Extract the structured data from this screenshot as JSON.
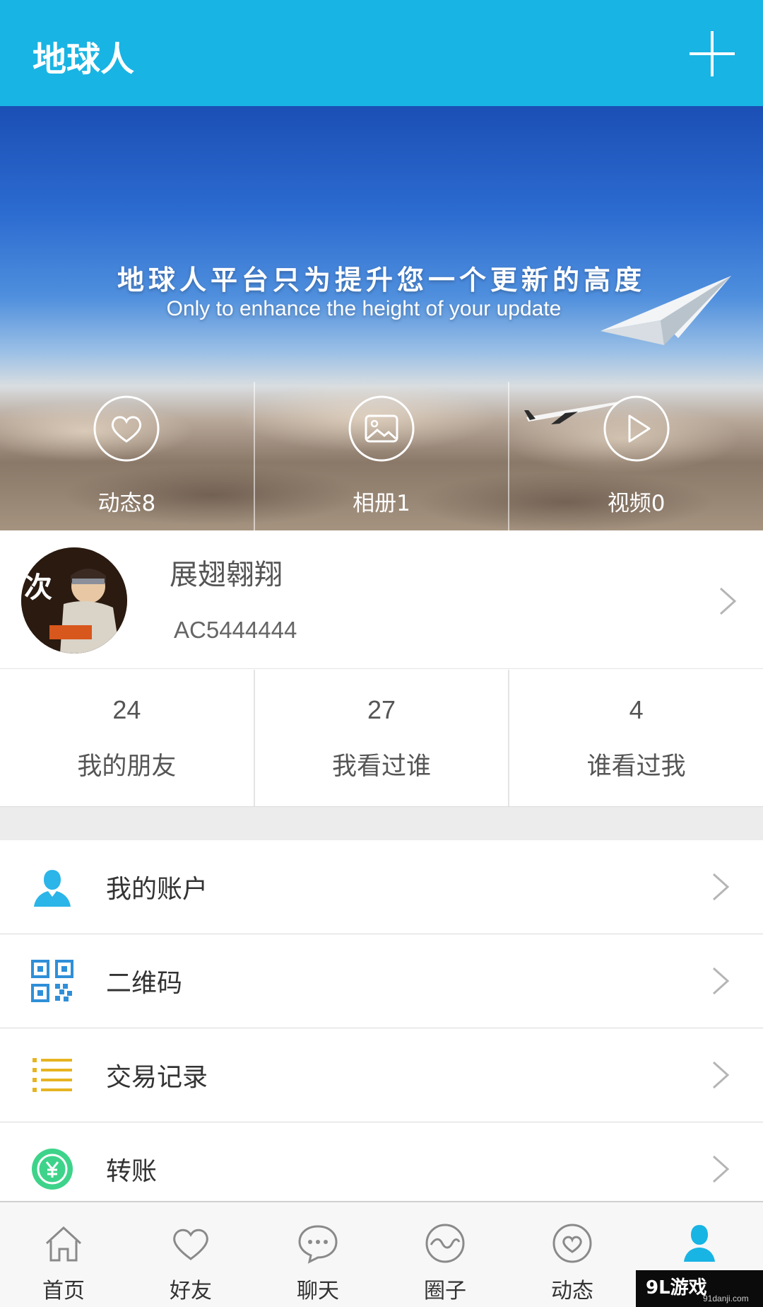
{
  "header": {
    "title": "地球人",
    "add_icon": "plus-icon"
  },
  "banner": {
    "slogan": "地球人平台只为提升您一个更新的高度",
    "slogan_en": "Only to enhance the height of your update",
    "stats": [
      {
        "label": "动态8",
        "icon": "heart-icon"
      },
      {
        "label": "相册1",
        "icon": "image-icon"
      },
      {
        "label": "视频0",
        "icon": "play-icon"
      }
    ]
  },
  "profile": {
    "name": "展翅翱翔",
    "id": "AC5444444"
  },
  "counts": [
    {
      "value": "24",
      "label": "我的朋友"
    },
    {
      "value": "27",
      "label": "我看过谁"
    },
    {
      "value": "4",
      "label": "谁看过我"
    }
  ],
  "menu": [
    {
      "label": "我的账户",
      "icon": "person-icon",
      "color": "#2bb5e8"
    },
    {
      "label": "二维码",
      "icon": "qr-code-icon",
      "color": "#2f8fd8"
    },
    {
      "label": "交易记录",
      "icon": "list-icon",
      "color": "#e6b422"
    },
    {
      "label": "转账",
      "icon": "yen-transfer-icon",
      "color": "#3ed38a"
    }
  ],
  "tabbar": [
    {
      "label": "首页",
      "icon": "home-icon"
    },
    {
      "label": "好友",
      "icon": "heart-outline-icon"
    },
    {
      "label": "聊天",
      "icon": "chat-bubble-icon"
    },
    {
      "label": "圈子",
      "icon": "wave-circle-icon"
    },
    {
      "label": "动态",
      "icon": "heart-circle-icon"
    },
    {
      "label": "",
      "icon": "person-icon",
      "active": true
    }
  ],
  "colors": {
    "primary": "#18b4e4",
    "text": "#333333",
    "muted": "#555555"
  },
  "watermark": {
    "logo": "9L游戏",
    "url": "91danji.com"
  }
}
